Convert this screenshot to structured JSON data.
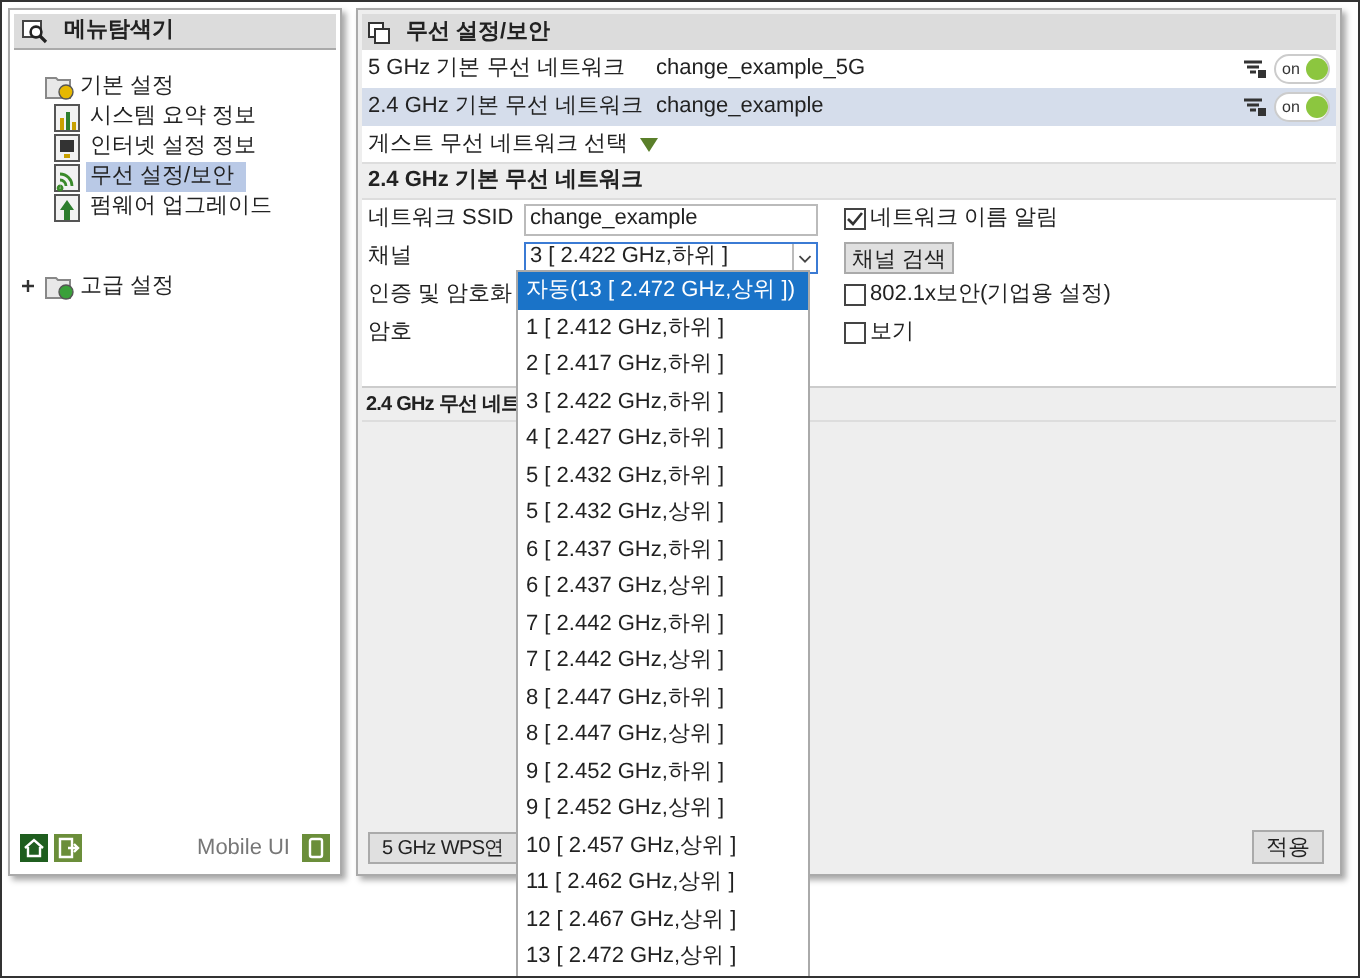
{
  "sidebar": {
    "title": "메뉴탐색기",
    "tree": [
      {
        "label": "기본 설정",
        "expanded": true,
        "children": [
          {
            "label": "시스템 요약 정보",
            "kind": "chart",
            "selected": false
          },
          {
            "label": "인터넷 설정 정보",
            "kind": "monitor",
            "selected": false
          },
          {
            "label": "무선 설정/보안",
            "kind": "wifi",
            "selected": true
          },
          {
            "label": "펌웨어 업그레이드",
            "kind": "upload",
            "selected": false
          }
        ]
      },
      {
        "label": "고급 설정",
        "expanded": false
      }
    ],
    "footer_label": "Mobile UI"
  },
  "main": {
    "title": "무선 설정/보안",
    "networks": [
      {
        "band": "5 GHz 기본 무선 네트워크",
        "ssid": "change_example_5G",
        "toggle": "on",
        "on": true,
        "selected": false
      },
      {
        "band": "2.4 GHz 기본 무선 네트워크",
        "ssid": "change_example",
        "toggle": "on",
        "on": true,
        "selected": true
      }
    ],
    "guest_select": "게스트 무선 네트워크 선택",
    "section": {
      "title": "2.4 GHz 기본 무선 네트워크",
      "rows": [
        {
          "kind": "input",
          "label": "네트워크 SSID",
          "value": "change_example",
          "option": {
            "label": "네트워크 이름 알림",
            "checked": true
          }
        },
        {
          "kind": "select",
          "label": "채널",
          "value": "3 [ 2.422 GHz,하위 ]",
          "button": "채널 검색"
        },
        {
          "kind": "check",
          "label": "인증 및 암호화",
          "option": {
            "label": "802.1x보안(기업용 설정)",
            "checked": false
          }
        },
        {
          "kind": "check",
          "label": "암호",
          "option": {
            "label": "보기",
            "checked": false
          }
        }
      ]
    },
    "section2_title": "2.4 GHz 무선 네트",
    "buttons": [
      "5 GHz WPS연",
      "적용"
    ]
  },
  "dropdown": {
    "options": [
      {
        "label": "자동(13 [ 2.472 GHz,상위 ])",
        "selected": true
      },
      {
        "label": "1 [ 2.412 GHz,하위 ]",
        "selected": false
      },
      {
        "label": "2 [ 2.417 GHz,하위 ]",
        "selected": false
      },
      {
        "label": "3 [ 2.422 GHz,하위 ]",
        "selected": false
      },
      {
        "label": "4 [ 2.427 GHz,하위 ]",
        "selected": false
      },
      {
        "label": "5 [ 2.432 GHz,하위 ]",
        "selected": false
      },
      {
        "label": "5 [ 2.432 GHz,상위 ]",
        "selected": false
      },
      {
        "label": "6 [ 2.437 GHz,하위 ]",
        "selected": false
      },
      {
        "label": "6 [ 2.437 GHz,상위 ]",
        "selected": false
      },
      {
        "label": "7 [ 2.442 GHz,하위 ]",
        "selected": false
      },
      {
        "label": "7 [ 2.442 GHz,상위 ]",
        "selected": false
      },
      {
        "label": "8 [ 2.447 GHz,하위 ]",
        "selected": false
      },
      {
        "label": "8 [ 2.447 GHz,상위 ]",
        "selected": false
      },
      {
        "label": "9 [ 2.452 GHz,하위 ]",
        "selected": false
      },
      {
        "label": "9 [ 2.452 GHz,상위 ]",
        "selected": false
      },
      {
        "label": "10 [ 2.457 GHz,상위 ]",
        "selected": false
      },
      {
        "label": "11 [ 2.462 GHz,상위 ]",
        "selected": false
      },
      {
        "label": "12 [ 2.467 GHz,상위 ]",
        "selected": false
      },
      {
        "label": "13 [ 2.472 GHz,상위 ]",
        "selected": false
      }
    ]
  }
}
